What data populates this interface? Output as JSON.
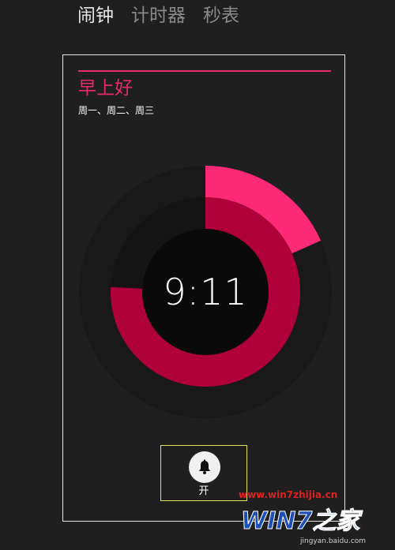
{
  "tabs": [
    {
      "label": "闹钟",
      "active": true
    },
    {
      "label": "计时器",
      "active": false
    },
    {
      "label": "秒表",
      "active": false
    }
  ],
  "alarm": {
    "name": "早上好",
    "days": "周一、周二、周三",
    "time": "9:11",
    "hour_ring_fraction": 0.7583,
    "minute_ring_fraction": 0.1833,
    "toggle_label": "开",
    "toggle_icon": "bell-icon"
  },
  "colors": {
    "background": "#1f1f1f",
    "accent": "#e8296e",
    "hour_ring": "#b0003a",
    "minute_ring": "#ff2a75",
    "toggle_border": "#e5e05a"
  },
  "watermark": {
    "url": "www.win7zhijia.cn",
    "logo_text": "WIN7之家",
    "sub_text": "jingyan.baidu.com"
  }
}
